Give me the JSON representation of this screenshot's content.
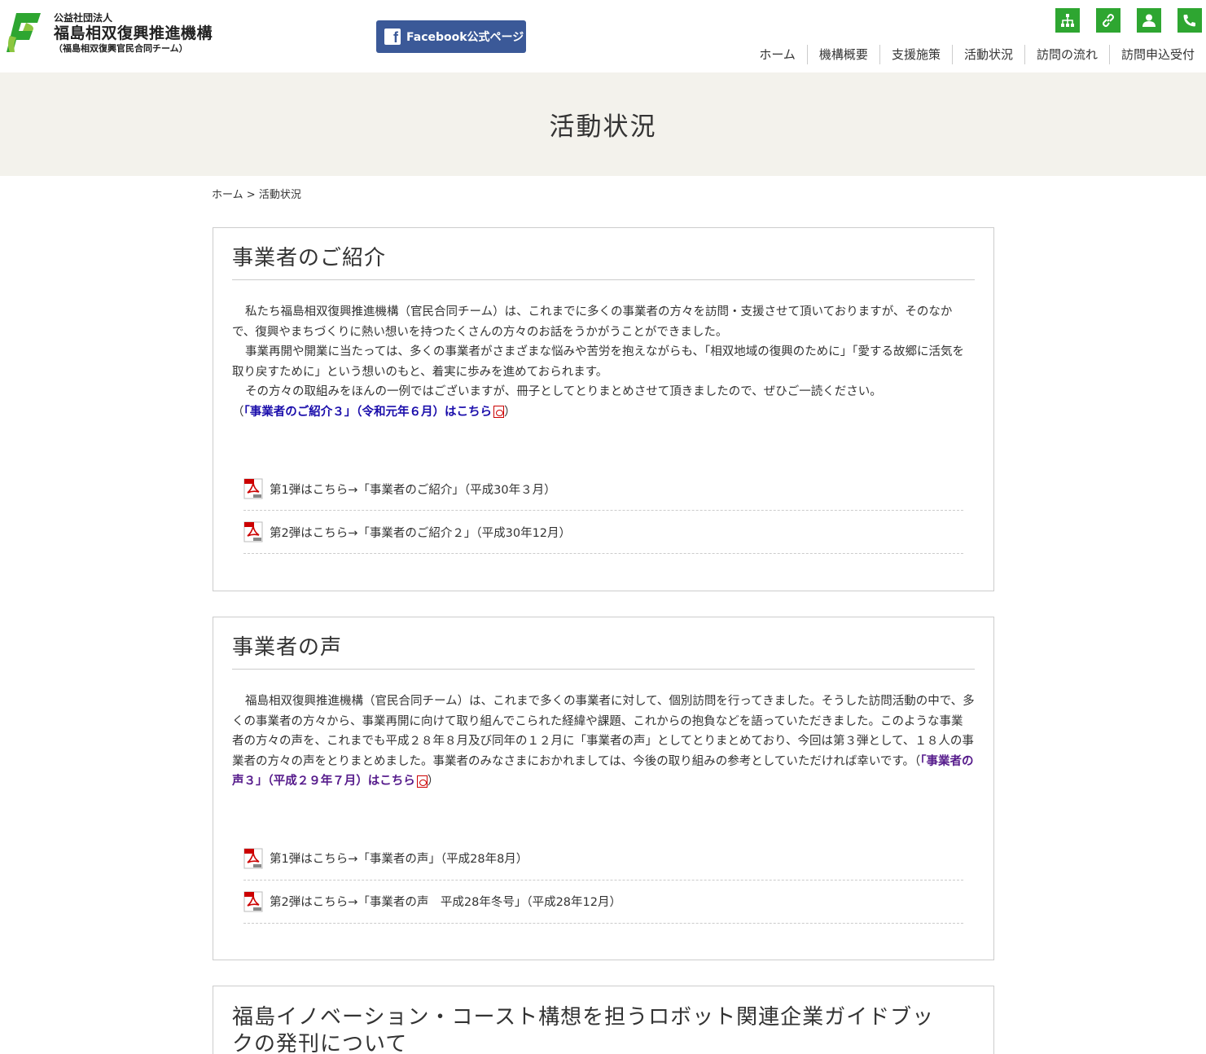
{
  "header": {
    "org_small": "公益社団法人",
    "org_main": "福島相双復興推進機構",
    "org_sub": "（福島相双復興官民合同チーム）",
    "facebook_label": "Facebook公式ページ",
    "nav": [
      "ホーム",
      "機構概要",
      "支援施策",
      "活動状況",
      "訪問の流れ",
      "訪問申込受付"
    ],
    "icon_buttons": [
      "sitemap-icon",
      "link-icon",
      "user-icon",
      "phone-icon"
    ],
    "accent_color": "#2ea631",
    "facebook_color": "#3b5998"
  },
  "page": {
    "title": "活動状況"
  },
  "breadcrumb": {
    "home": "ホーム",
    "separator": ">",
    "current": "活動状況"
  },
  "sections": [
    {
      "title": "事業者のご紹介",
      "paragraphs": [
        "私たち福島相双復興推進機構（官民合同チーム）は、これまでに多くの事業者の方々を訪問・支援させて頂いておりますが、そのなかで、復興やまちづくりに熱い想いを持つたくさんの方々のお話をうかがうことができました。",
        "事業再開や開業に当たっては、多くの事業者がさまざまな悩みや苦労を抱えながらも、「相双地域の復興のために」「愛する故郷に活気を取り戻すために」という想いのもと、着実に歩みを進めておられます。",
        "その方々の取組みをほんの一例ではございますが、冊子としてとりまとめさせて頂きましたので、ぜひご一読ください。"
      ],
      "link_prefix": "（",
      "link_text": "「事業者のご紹介３」（令和元年６月）はこちら",
      "link_suffix": "）",
      "pdfs": [
        "第1弾はこちら→「事業者のご紹介」（平成30年３月）",
        "第2弾はこちら→「事業者のご紹介２」（平成30年12月）"
      ]
    },
    {
      "title": "事業者の声",
      "paragraph": "福島相双復興推進機構（官民合同チーム）は、これまで多くの事業者に対して、個別訪問を行ってきました。そうした訪問活動の中で、多くの事業者の方々から、事業再開に向けて取り組んでこられた経緯や課題、これからの抱負などを語っていただきました。このような事業者の方々の声を、これまでも平成２８年８月及び同年の１２月に「事業者の声」としてとりまとめており、今回は第３弾として、１８人の事業者の方々の声をとりまとめました。事業者のみなさまにおかれましては、今後の取り組みの参考としていただければ幸いです。",
      "link_prefix": "（",
      "link_text": "「事業者の声３」（平成２９年７月）はこちら",
      "link_suffix": "）",
      "pdfs": [
        "第1弾はこちら→「事業者の声」（平成28年8月）",
        "第2弾はこちら→「事業者の声　平成28年冬号」（平成28年12月）"
      ]
    },
    {
      "title": "福島イノベーション・コースト構想を担うロボット関連企業ガイドブックの発刊について"
    }
  ]
}
